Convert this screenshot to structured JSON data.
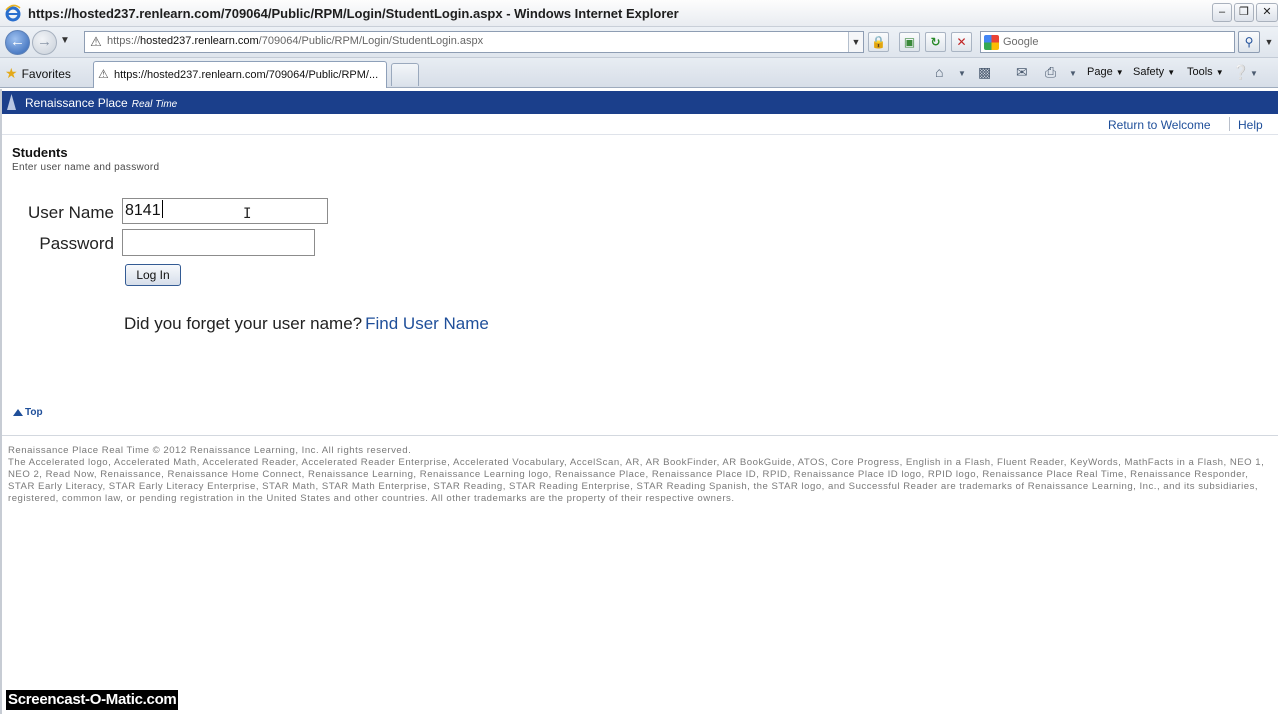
{
  "window": {
    "title": "https://hosted237.renlearn.com/709064/Public/RPM/Login/StudentLogin.aspx - Windows Internet Explorer"
  },
  "address_bar": {
    "url_prefix": "https://",
    "url_host": "hosted237.renlearn.com",
    "url_path": "/709064/Public/RPM/Login/StudentLogin.aspx"
  },
  "search": {
    "placeholder": "Google"
  },
  "favorites_label": "Favorites",
  "tab": {
    "label": "https://hosted237.renlearn.com/709064/Public/RPM/..."
  },
  "command_bar": {
    "page": "Page",
    "safety": "Safety",
    "tools": "Tools"
  },
  "banner": {
    "brand": "Renaissance Place",
    "brand_sub": "Real Time"
  },
  "subnav": {
    "return_link": "Return to Welcome",
    "help_link": "Help"
  },
  "login": {
    "heading": "Students",
    "instructions": "Enter user name and password",
    "username_label": "User Name",
    "username_value": "8141",
    "password_label": "Password",
    "password_value": "",
    "login_button": "Log In",
    "forgot_text": "Did you forget your user name?",
    "forgot_link": "Find User Name"
  },
  "top_link": "Top",
  "footer": {
    "copyright": "Renaissance Place Real Time © 2012 Renaissance Learning, Inc. All rights reserved.",
    "trademarks": "The Accelerated logo, Accelerated Math, Accelerated Reader, Accelerated Reader Enterprise, Accelerated Vocabulary, AccelScan, AR, AR BookFinder, AR BookGuide, ATOS, Core Progress, English in a Flash, Fluent Reader, KeyWords, MathFacts in a Flash, NEO 1, NEO 2, Read Now, Renaissance, Renaissance Home Connect, Renaissance Learning, Renaissance Learning logo, Renaissance Place, Renaissance Place ID, RPID, Renaissance Place ID logo, RPID logo, Renaissance Place Real Time, Renaissance Responder, STAR Early Literacy, STAR Early Literacy Enterprise, STAR Math, STAR Math Enterprise, STAR Reading, STAR Reading Enterprise, STAR Reading Spanish, the STAR logo, and Successful Reader are trademarks of Renaissance Learning, Inc., and its subsidiaries, registered, common law, or pending registration in the United States and other countries. All other trademarks are the property of their respective owners."
  },
  "watermark": "Screencast-O-Matic.com",
  "colors": {
    "banner": "#1b3f8b",
    "link": "#1f4f9a"
  }
}
